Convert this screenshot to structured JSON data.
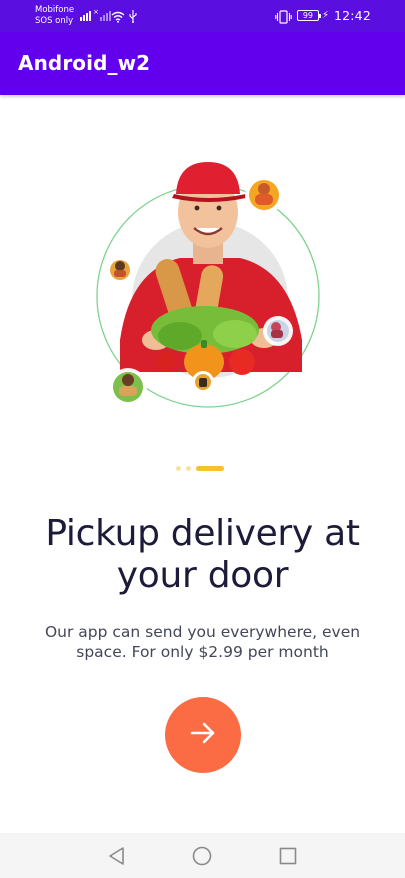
{
  "status_bar": {
    "carrier_line1": "Mobifone",
    "carrier_line2": "SOS only",
    "battery_level": "99",
    "time": "12:42",
    "icons": [
      "signal-icon",
      "wifi-icon",
      "usb-icon",
      "vibrate-icon",
      "battery-icon",
      "charging-icon"
    ]
  },
  "app_bar": {
    "title": "Android_w2",
    "color": "#6200ee"
  },
  "onboarding": {
    "illustration": "delivery-courier-image",
    "pager": {
      "total": 3,
      "active_index": 2
    },
    "headline_line1": "Pickup delivery at",
    "headline_line2": "your door",
    "subtitle_line1": "Our app can send you everywhere, even",
    "subtitle_line2": "space. For only $2.99 per month",
    "next_icon": "arrow-right-icon",
    "accent_color": "#fb6c44",
    "pager_color": "#f5c12e"
  },
  "nav_bar": {
    "buttons": [
      "back-icon",
      "home-icon",
      "recents-icon"
    ]
  }
}
